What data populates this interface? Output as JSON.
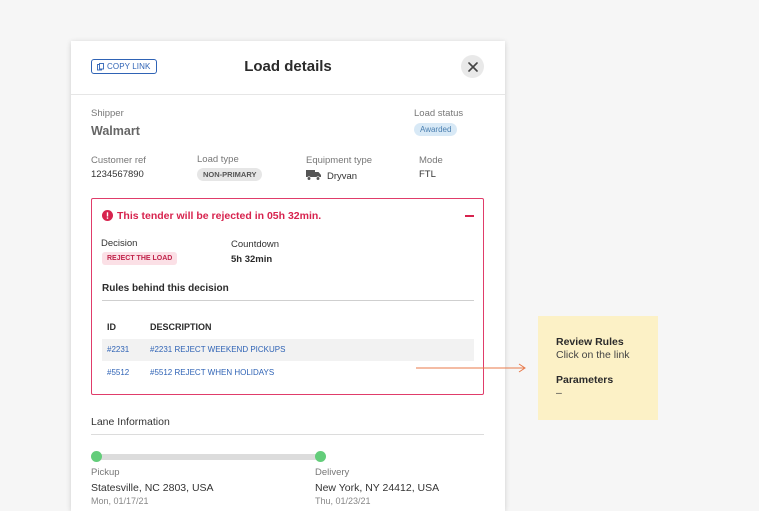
{
  "header": {
    "copy_link": "COPY LINK",
    "title": "Load details"
  },
  "shipper": {
    "label": "Shipper",
    "value": "Walmart"
  },
  "load_status": {
    "label": "Load status",
    "value": "Awarded"
  },
  "details": {
    "customer_ref": {
      "label": "Customer ref",
      "value": "1234567890"
    },
    "load_type": {
      "label": "Load type",
      "value": "NON-PRIMARY"
    },
    "equipment_type": {
      "label": "Equipment type",
      "value": "Dryvan",
      "icon": "truck-icon"
    },
    "mode": {
      "label": "Mode",
      "value": "FTL"
    }
  },
  "alert": {
    "message": "This tender will be rejected in  05h 32min.",
    "decision_label": "Decision",
    "decision_value": "REJECT THE LOAD",
    "countdown_label": "Countdown",
    "countdown_value": "5h 32min",
    "rules_title": "Rules behind this decision",
    "columns": [
      "ID",
      "DESCRIPTION"
    ],
    "rules": [
      {
        "id": "#2231",
        "description": "#2231 REJECT WEEKEND PICKUPS"
      },
      {
        "id": "#5512",
        "description": "#5512 REJECT WHEN HOLIDAYS"
      }
    ]
  },
  "lane": {
    "title": "Lane Information",
    "pickup": {
      "label": "Pickup",
      "location": "Statesville, NC 2803, USA",
      "date": "Mon, 01/17/21"
    },
    "delivery": {
      "label": "Delivery",
      "location": "New York, NY 24412, USA",
      "date": "Thu, 01/23/21"
    }
  },
  "annotation": {
    "heading1": "Review Rules",
    "text1": "Click on the link",
    "heading2": "Parameters",
    "text2": "–"
  },
  "colors": {
    "accent": "#2f63b5",
    "alert": "#d7234e",
    "progress": "#63cd7a",
    "note": "#fcf1c6"
  }
}
